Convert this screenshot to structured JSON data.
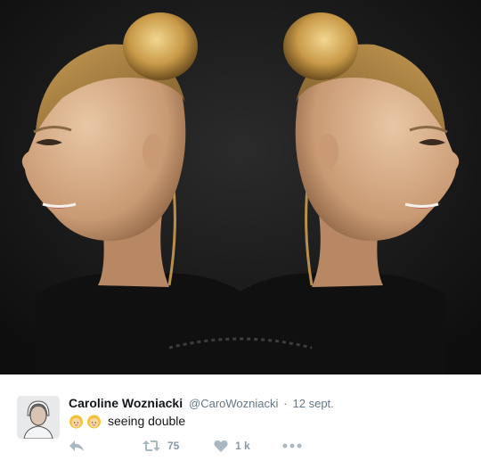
{
  "media": {
    "icon": "photo-image"
  },
  "tweet": {
    "display_name": "Caroline Wozniacki",
    "handle": "@CaroWozniacki",
    "separator": "·",
    "date": "12 sept.",
    "emoji": [
      "woman-blonde-emoji",
      "woman-blonde-emoji"
    ],
    "text": "seeing double"
  },
  "actions": {
    "reply_icon": "reply-icon",
    "retweet_icon": "retweet-icon",
    "retweet_count": "75",
    "like_icon": "heart-icon",
    "like_count": "1 k",
    "more_icon": "more-icon"
  },
  "colors": {
    "icon_gray": "#aab8c2",
    "text_muted": "#657786",
    "emoji_hair": "#f3c13a",
    "emoji_skin": "#f6d7a7"
  }
}
